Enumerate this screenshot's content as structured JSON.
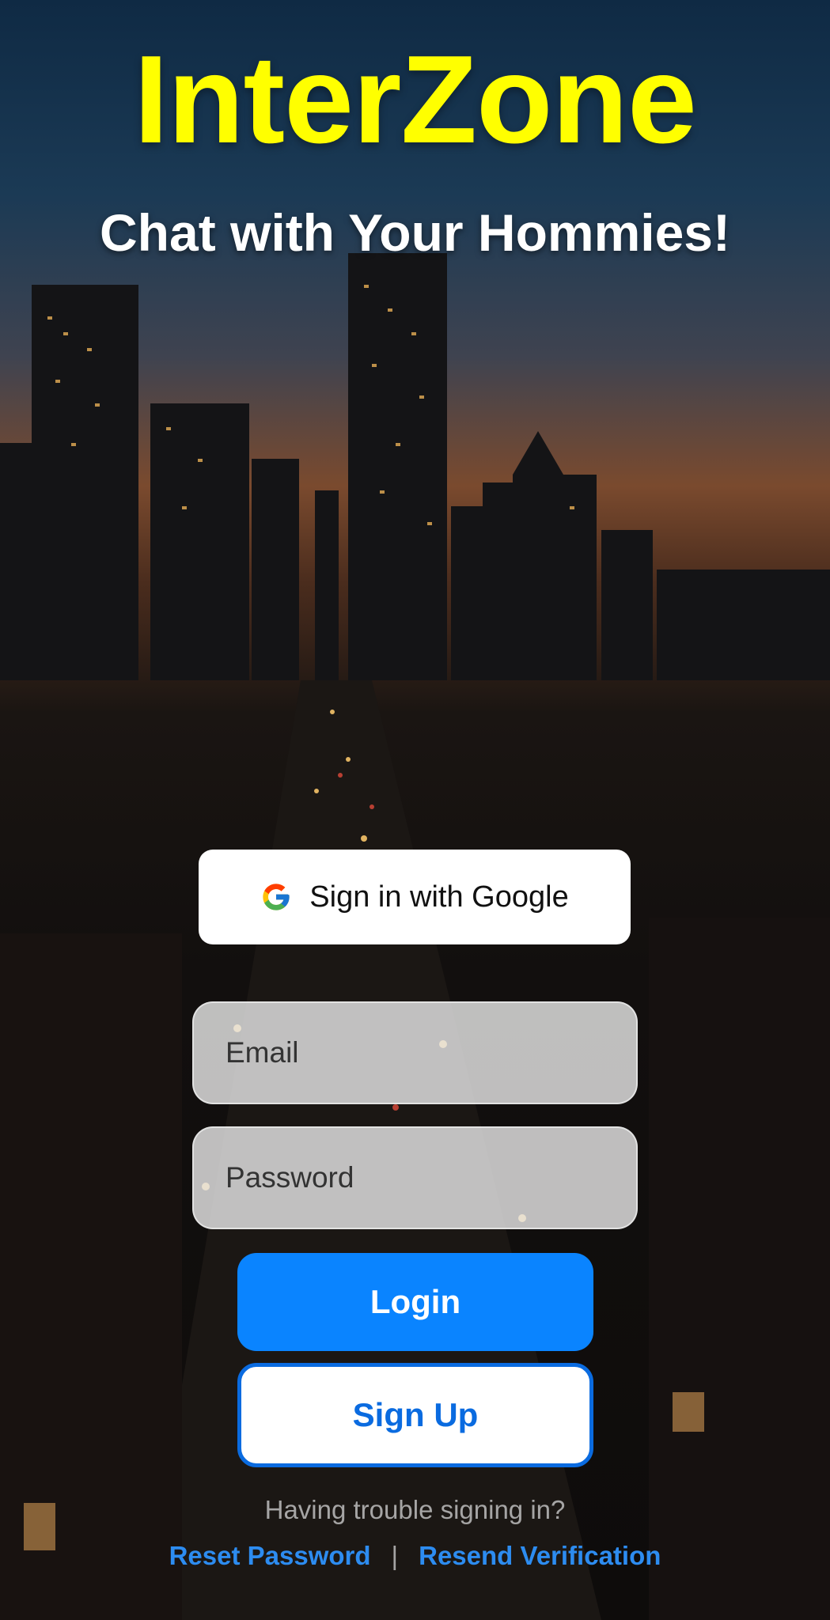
{
  "app": {
    "title": "InterZone",
    "subtitle": "Chat with Your Hommies!"
  },
  "colors": {
    "title": "#ffff00",
    "primary": "#0a84ff",
    "link": "#2d8cf0"
  },
  "google": {
    "label": "Sign in with Google",
    "icon": "google-g-icon"
  },
  "form": {
    "email_placeholder": "Email",
    "password_placeholder": "Password"
  },
  "buttons": {
    "login": "Login",
    "signup": "Sign Up"
  },
  "footer": {
    "trouble": "Having trouble signing in?",
    "reset": "Reset Password",
    "separator": "|",
    "resend": "Resend Verification"
  }
}
